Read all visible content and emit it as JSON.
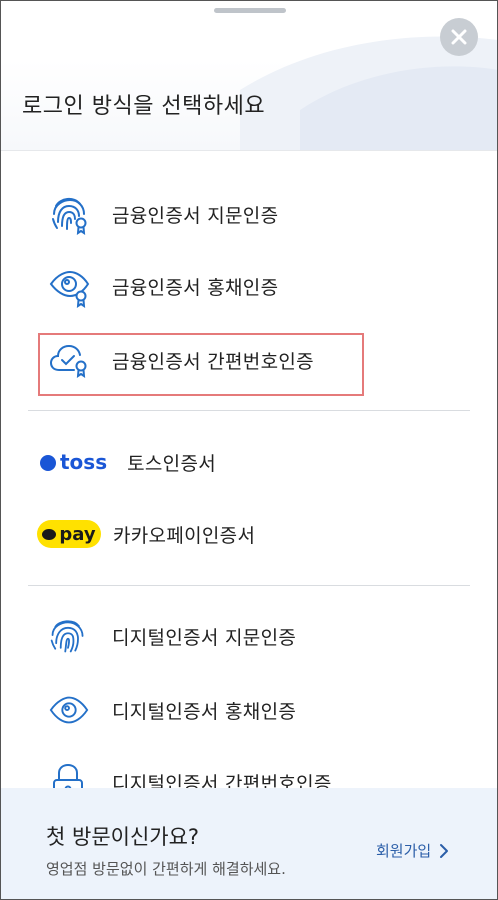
{
  "header": {
    "title": "로그인 방식을 선택하세요",
    "close_icon": "close-icon"
  },
  "sections": {
    "financial": [
      {
        "label": "금융인증서 지문인증",
        "icon": "fingerprint-certificate-icon"
      },
      {
        "label": "금융인증서 홍채인증",
        "icon": "eye-certificate-icon"
      },
      {
        "label": "금융인증서 간편번호인증",
        "icon": "cloud-check-certificate-icon",
        "highlighted": true
      }
    ],
    "private": [
      {
        "label": "토스인증서",
        "logo_text": "toss"
      },
      {
        "label": "카카오페이인증서",
        "logo_text": "pay"
      }
    ],
    "digital": [
      {
        "label": "디지털인증서 지문인증",
        "icon": "fingerprint-icon"
      },
      {
        "label": "디지털인증서 홍채인증",
        "icon": "eye-icon"
      },
      {
        "label": "디지털인증서 간편번호인증",
        "icon": "lock-icon"
      }
    ]
  },
  "footer": {
    "title": "첫 방문이신가요?",
    "subtitle": "영업점 방문없이 간편하게 해결하세요.",
    "link_label": "회원가입"
  },
  "colors": {
    "accent_blue": "#1a56d6",
    "icon_blue": "#2470c8",
    "toss_blue": "#1a56d6",
    "kakao_yellow": "#ffe100",
    "highlight_red": "#e57a7a",
    "footer_bg": "#edf3fb",
    "link_blue": "#2b5ea8"
  }
}
